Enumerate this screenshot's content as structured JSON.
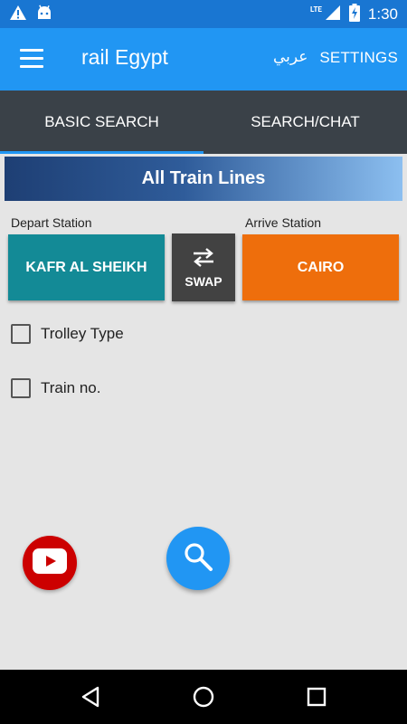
{
  "status_bar": {
    "left_icons": [
      "warning-icon",
      "android-icon"
    ],
    "network": "LTE",
    "time": "1:30"
  },
  "app_bar": {
    "title": "rail Egypt",
    "language_label": "عربي",
    "settings_label": "SETTINGS"
  },
  "tabs": [
    {
      "label": "BASIC SEARCH",
      "active": true
    },
    {
      "label": "SEARCH/CHAT",
      "active": false
    }
  ],
  "banner": {
    "label": "All Train Lines"
  },
  "depart": {
    "label": "Depart Station",
    "value": "KAFR AL SHEIKH"
  },
  "arrive": {
    "label": "Arrive Station",
    "value": "CAIRO"
  },
  "swap": {
    "label": "SWAP"
  },
  "options": [
    {
      "label": "Trolley Type",
      "checked": false
    },
    {
      "label": "Train no.",
      "checked": false
    }
  ],
  "colors": {
    "primary": "#2196f3",
    "status_bar": "#1976d2",
    "tab_bar": "#3a4148",
    "depart": "#138a96",
    "arrive": "#ee6e0c",
    "swap": "#424242",
    "youtube": "#cc0000"
  },
  "nav": [
    "back-icon",
    "home-icon",
    "recents-icon"
  ]
}
